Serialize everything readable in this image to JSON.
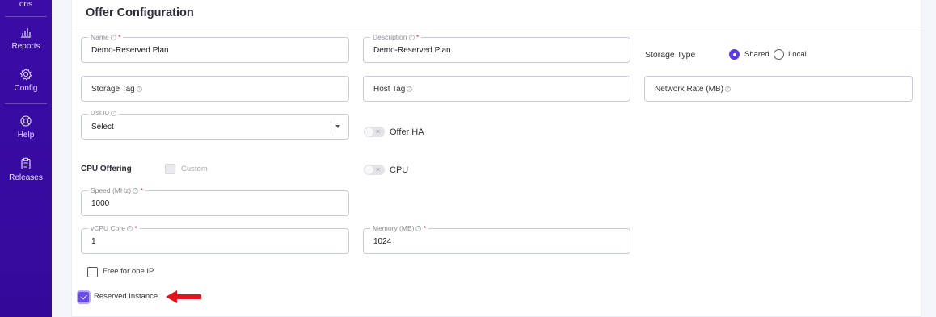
{
  "sidebar": {
    "items": [
      {
        "label": "ons",
        "icon": "truncated-nav-item"
      },
      {
        "label": "Reports",
        "icon": "bar-chart-icon"
      },
      {
        "label": "Config",
        "icon": "gear-icon"
      },
      {
        "label": "Help",
        "icon": "lifebuoy-icon"
      },
      {
        "label": "Releases",
        "icon": "clipboard-icon"
      }
    ],
    "color": "#3a0ca3"
  },
  "card": {
    "title": "Offer Configuration"
  },
  "form": {
    "name": {
      "label": "Name",
      "value": "Demo-Reserved Plan",
      "required": "*"
    },
    "description": {
      "label": "Description",
      "value": "Demo-Reserved Plan",
      "required": "*"
    },
    "storage_type": {
      "label": "Storage Type",
      "options": [
        "Shared",
        "Local"
      ],
      "selected": "Shared"
    },
    "storage_tag": {
      "placeholder": "Storage Tag"
    },
    "host_tag": {
      "placeholder": "Host Tag"
    },
    "network_rate": {
      "placeholder": "Network Rate (MB)"
    },
    "disk_io": {
      "label": "Disk IO",
      "value": "Select"
    },
    "offer_ha": {
      "label": "Offer HA",
      "on": false
    },
    "cpu_offering": {
      "label": "CPU Offering"
    },
    "custom": {
      "label": "Custom",
      "checked": false,
      "disabled": true
    },
    "cpu_toggle": {
      "label": "CPU",
      "on": false
    },
    "speed": {
      "label": "Speed (MHz)",
      "value": "1000",
      "required": "*"
    },
    "vcpu": {
      "label": "vCPU Core",
      "value": "1",
      "required": "*"
    },
    "memory": {
      "label": "Memory (MB)",
      "value": "1024",
      "required": "*"
    },
    "free_ip": {
      "label": "Free for one IP",
      "checked": false
    },
    "reserved": {
      "label": "Reserved Instance",
      "checked": true
    }
  },
  "colors": {
    "accent": "#5b3be3",
    "required": "#e0233b",
    "annotation_arrow": "#e3151a"
  }
}
